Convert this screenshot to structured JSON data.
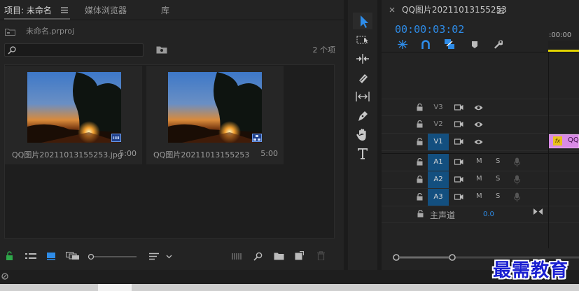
{
  "project_panel": {
    "tabs": [
      {
        "label": "项目: 未命名"
      },
      {
        "label": "媒体浏览器"
      },
      {
        "label": "库"
      }
    ],
    "project_file": "未命名.prproj",
    "search": {
      "value": "",
      "placeholder": ""
    },
    "item_count": "2 个项",
    "clips": [
      {
        "name": "QQ图片20211013155253.jpg",
        "duration": "5:00",
        "badge": "still-image-icon"
      },
      {
        "name": "QQ图片20211013155253",
        "duration": "5:00",
        "badge": "sequence-icon"
      }
    ]
  },
  "tools": {
    "items": [
      "selection-tool",
      "track-select-tool",
      "ripple-edit-tool",
      "razor-tool",
      "slip-tool",
      "pen-tool",
      "hand-tool",
      "type-tool"
    ],
    "selected": "selection-tool"
  },
  "timeline": {
    "sequence_name": "QQ图片20211013155253",
    "timecode": "00:00:03:02",
    "ruler_time": ":00:00",
    "video_tracks": [
      {
        "label": "V3",
        "targeted": false
      },
      {
        "label": "V2",
        "targeted": false
      },
      {
        "label": "V1",
        "targeted": true
      }
    ],
    "audio_tracks": [
      {
        "label": "A1",
        "targeted": true,
        "m": "M",
        "s": "S"
      },
      {
        "label": "A2",
        "targeted": true,
        "m": "M",
        "s": "S"
      },
      {
        "label": "A3",
        "targeted": true,
        "m": "M",
        "s": "S"
      }
    ],
    "master": {
      "label": "主声道",
      "value": "0.0"
    },
    "clip_label": "QQ",
    "clip_fx": "fx"
  },
  "watermark": "最需教育",
  "colors": {
    "accent": "#2e8ce8",
    "track_target": "#134f7f",
    "clip": "#d98be6",
    "playhead": "#e2d400"
  }
}
